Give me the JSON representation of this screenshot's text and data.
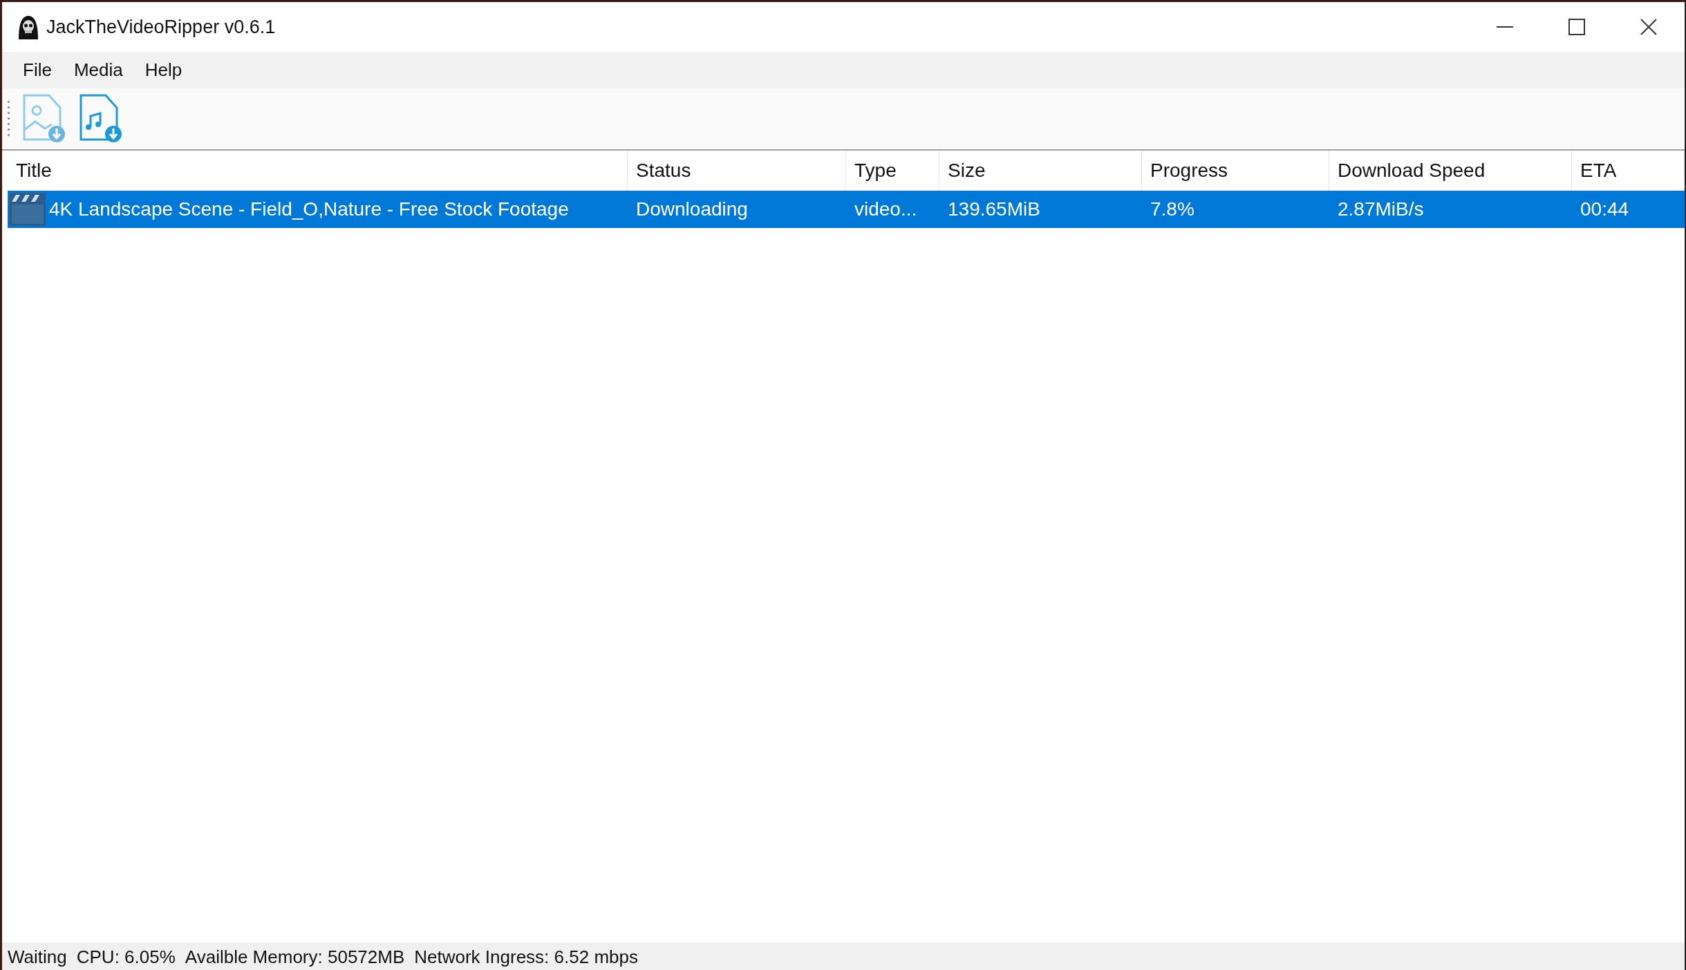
{
  "window": {
    "title": "JackTheVideoRipper v0.6.1"
  },
  "menu": [
    "File",
    "Media",
    "Help"
  ],
  "table": {
    "columns": [
      "Title",
      "Status",
      "Type",
      "Size",
      "Progress",
      "Download Speed",
      "ETA"
    ],
    "rows": [
      {
        "selected": true,
        "cells": [
          "4K Landscape Scene - Field_O,Nature - Free Stock Footage",
          "Downloading",
          "video...",
          "139.65MiB",
          "7.8%",
          "2.87MiB/s",
          "00:44"
        ]
      }
    ]
  },
  "status_bar": [
    "Waiting",
    "CPU: 6.05%",
    "Availble Memory: 50572MB",
    "Network Ingress: 6.52 mbps"
  ]
}
